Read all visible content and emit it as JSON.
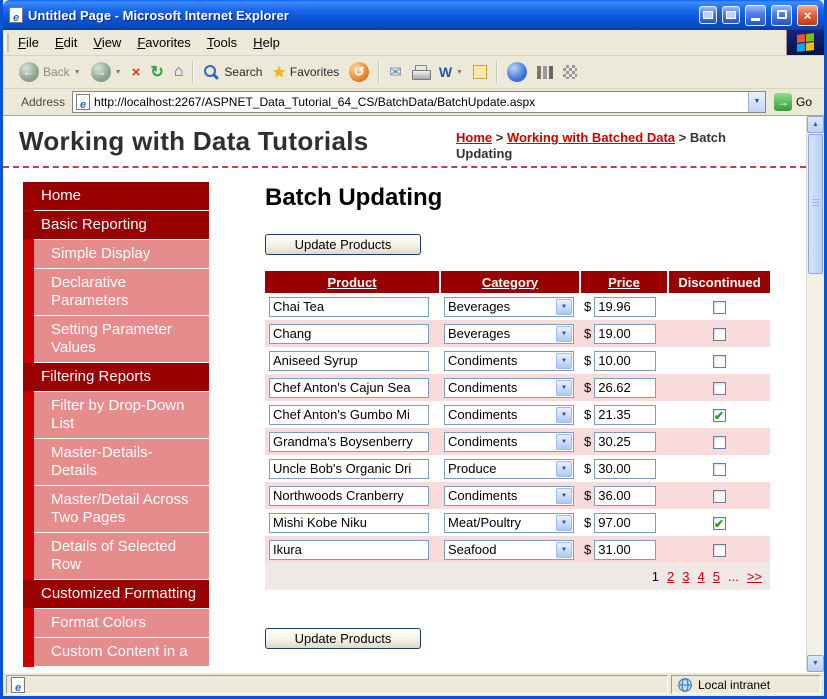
{
  "window": {
    "title": "Untitled Page - Microsoft Internet Explorer"
  },
  "menubar": {
    "items": [
      "File",
      "Edit",
      "View",
      "Favorites",
      "Tools",
      "Help"
    ]
  },
  "toolbar": {
    "back_label": "Back",
    "search_label": "Search",
    "favorites_label": "Favorites"
  },
  "addressbar": {
    "label": "Address",
    "url": "http://localhost:2267/ASPNET_Data_Tutorial_64_CS/BatchData/BatchUpdate.aspx",
    "go_label": "Go"
  },
  "page": {
    "site_title": "Working with Data Tutorials",
    "breadcrumb": {
      "links": [
        "Home",
        "Working with Batched Data"
      ],
      "separator": ">",
      "current": "Batch Updating"
    },
    "sidebar": [
      {
        "label": "Home",
        "level": 0
      },
      {
        "label": "Basic Reporting",
        "level": 0
      },
      {
        "label": "Simple Display",
        "level": 1
      },
      {
        "label": "Declarative Parameters",
        "level": 1
      },
      {
        "label": "Setting Parameter Values",
        "level": 1
      },
      {
        "label": "Filtering Reports",
        "level": 0
      },
      {
        "label": "Filter by Drop-Down List",
        "level": 1
      },
      {
        "label": "Master-Details-Details",
        "level": 1
      },
      {
        "label": "Master/Detail Across Two Pages",
        "level": 1
      },
      {
        "label": "Details of Selected Row",
        "level": 1
      },
      {
        "label": "Customized Formatting",
        "level": 0
      },
      {
        "label": "Format Colors",
        "level": 1
      },
      {
        "label": "Custom Content in a",
        "level": 1
      }
    ],
    "main": {
      "heading": "Batch Updating",
      "update_button": "Update Products",
      "table": {
        "headers": [
          {
            "label": "Product",
            "sortable": true
          },
          {
            "label": "Category",
            "sortable": true
          },
          {
            "label": "Price",
            "sortable": true
          },
          {
            "label": "Discontinued",
            "sortable": false
          }
        ],
        "currency": "$",
        "rows": [
          {
            "product": "Chai Tea",
            "category": "Beverages",
            "price": "19.96",
            "discontinued": false
          },
          {
            "product": "Chang",
            "category": "Beverages",
            "price": "19.00",
            "discontinued": false
          },
          {
            "product": "Aniseed Syrup",
            "category": "Condiments",
            "price": "10.00",
            "discontinued": false
          },
          {
            "product": "Chef Anton's Cajun Sea",
            "category": "Condiments",
            "price": "26.62",
            "discontinued": false
          },
          {
            "product": "Chef Anton's Gumbo Mi",
            "category": "Condiments",
            "price": "21.35",
            "discontinued": true
          },
          {
            "product": "Grandma's Boysenberry",
            "category": "Condiments",
            "price": "30.25",
            "discontinued": false
          },
          {
            "product": "Uncle Bob's Organic Dri",
            "category": "Produce",
            "price": "30.00",
            "discontinued": false
          },
          {
            "product": "Northwoods Cranberry",
            "category": "Condiments",
            "price": "36.00",
            "discontinued": false
          },
          {
            "product": "Mishi Kobe Niku",
            "category": "Meat/Poultry",
            "price": "97.00",
            "discontinued": true
          },
          {
            "product": "Ikura",
            "category": "Seafood",
            "price": "31.00",
            "discontinued": false
          }
        ]
      },
      "pager": {
        "current": "1",
        "pages": [
          "2",
          "3",
          "4",
          "5"
        ],
        "ellipsis": "...",
        "next": ">>"
      }
    }
  },
  "statusbar": {
    "zone": "Local intranet"
  },
  "icons": {
    "back_arrow": "←",
    "forward_arrow": "→",
    "stop": "×",
    "refresh": "↻",
    "home": "⌂",
    "favorites_star": "★",
    "history": "↺",
    "mail": "✉",
    "word": "W",
    "dropdown": "▼",
    "check": "✔",
    "go_arrow": "→",
    "close": "×",
    "scroll_up": "▲",
    "scroll_down": "▼"
  },
  "colors": {
    "maroon": "#990000",
    "nav_strip": "#CC0000",
    "nav_sub": "#E78C8C",
    "alt_row": "#FADBDB",
    "link_red": "#CC0000"
  }
}
